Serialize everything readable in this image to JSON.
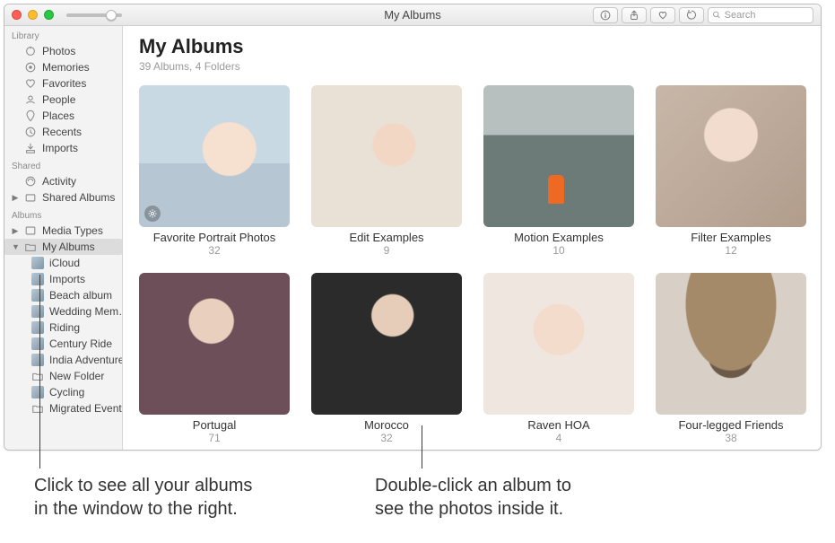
{
  "window": {
    "title": "My Albums",
    "search_placeholder": "Search"
  },
  "sidebar": {
    "sections": [
      {
        "header": "Library",
        "items": [
          {
            "label": "Photos",
            "icon": "photos-icon"
          },
          {
            "label": "Memories",
            "icon": "memories-icon"
          },
          {
            "label": "Favorites",
            "icon": "heart-icon"
          },
          {
            "label": "People",
            "icon": "people-icon"
          },
          {
            "label": "Places",
            "icon": "pin-icon"
          },
          {
            "label": "Recents",
            "icon": "clock-icon"
          },
          {
            "label": "Imports",
            "icon": "import-icon"
          }
        ]
      },
      {
        "header": "Shared",
        "items": [
          {
            "label": "Activity",
            "icon": "activity-icon"
          },
          {
            "label": "Shared Albums",
            "icon": "shared-icon",
            "disclosure": "right"
          }
        ]
      },
      {
        "header": "Albums",
        "items": [
          {
            "label": "Media Types",
            "icon": "media-icon",
            "disclosure": "right"
          },
          {
            "label": "My Albums",
            "icon": "folder-icon",
            "disclosure": "down",
            "selected": true,
            "children": [
              {
                "label": "iCloud",
                "thumb": true
              },
              {
                "label": "Imports",
                "thumb": true
              },
              {
                "label": "Beach album",
                "thumb": true
              },
              {
                "label": "Wedding Mem…",
                "thumb": true
              },
              {
                "label": "Riding",
                "thumb": true
              },
              {
                "label": "Century Ride",
                "thumb": true
              },
              {
                "label": "India Adventure",
                "thumb": true
              },
              {
                "label": "New Folder",
                "icon": "folder-icon"
              },
              {
                "label": "Cycling",
                "thumb": true
              },
              {
                "label": "Migrated Events",
                "icon": "folder-icon"
              }
            ]
          }
        ]
      }
    ]
  },
  "content": {
    "title": "My Albums",
    "subtitle": "39 Albums, 4 Folders",
    "albums": [
      {
        "title": "Favorite Portrait Photos",
        "count": "32",
        "smart": true
      },
      {
        "title": "Edit Examples",
        "count": "9"
      },
      {
        "title": "Motion Examples",
        "count": "10"
      },
      {
        "title": "Filter Examples",
        "count": "12"
      },
      {
        "title": "Portugal",
        "count": "71"
      },
      {
        "title": "Morocco",
        "count": "32"
      },
      {
        "title": "Raven HOA",
        "count": "4"
      },
      {
        "title": "Four-legged Friends",
        "count": "38"
      }
    ]
  },
  "callouts": {
    "left": "Click to see all your albums\nin the window to the right.",
    "right": "Double-click an album to\nsee the photos inside it."
  }
}
